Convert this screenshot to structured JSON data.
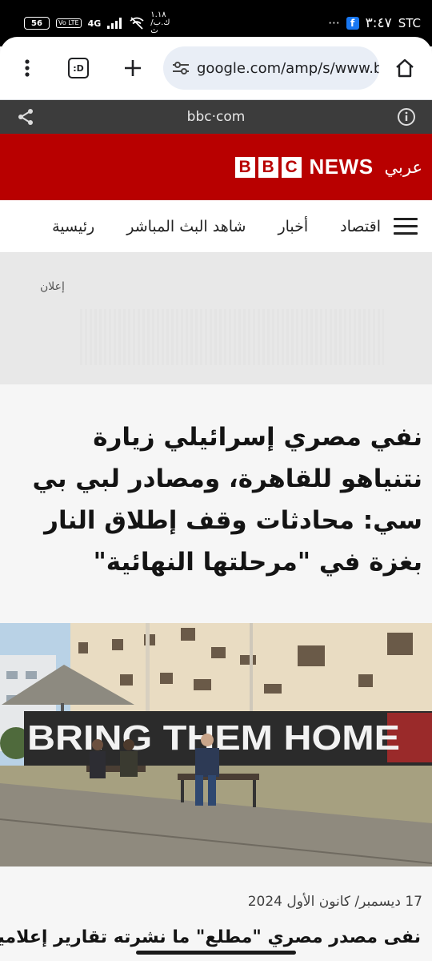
{
  "status_bar": {
    "battery": "56",
    "network": "4G",
    "volte": "Vo LTE",
    "speed": "١.١٨ ك.ب/ث",
    "dots": "···",
    "time": "٣:٤٧",
    "carrier": "STC"
  },
  "browser": {
    "url": "google.com/amp/s/www.bbc",
    "tab_switcher_label": ":D"
  },
  "amp_bar": {
    "domain": "bbc·com"
  },
  "bbc": {
    "blocks": [
      "B",
      "B",
      "C"
    ],
    "news": "NEWS",
    "arabic": "عربي"
  },
  "nav": {
    "items": [
      "رئيسية",
      "شاهد البث المباشر",
      "أخبار",
      "اقتصاد"
    ]
  },
  "ad": {
    "label": "إعلان"
  },
  "article": {
    "headline": "نفي مصري إسرائيلي زيارة نتنياهو للقاهرة، ومصادر لبي بي سي: محادثات وقف إطلاق النار بغزة في \"مرحلتها النهائية\"",
    "image_text": "BRING THEM HOME",
    "date": "17 ديسمبر/ كانون الأول 2024",
    "teaser": "نفى مصدر مصري \"مطلع\" ما نشرته تقارير إعلامية"
  },
  "colors": {
    "bbc_red": "#b80000",
    "amp_bar": "#3c3c3c",
    "url_pill": "#e9eef6"
  }
}
